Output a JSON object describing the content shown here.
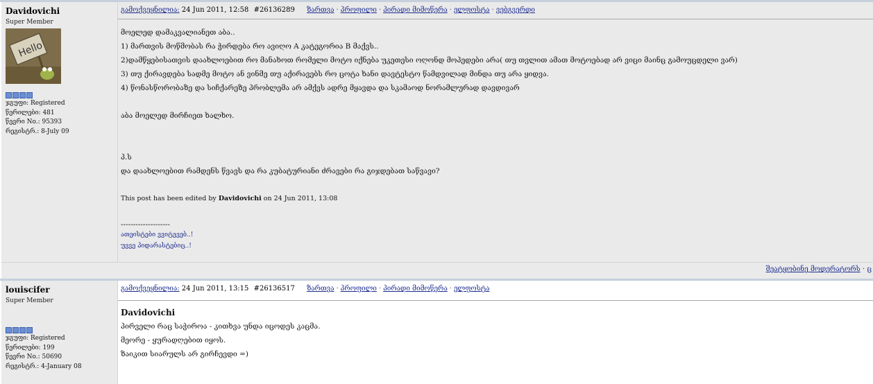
{
  "post1": {
    "username": "Davidovichi",
    "user_title": "Super Member",
    "avatar_text": "Hello",
    "info": [
      "ჯგუფი: Registered",
      "წერილები: 481",
      "წევრი No.: 95393",
      "რეგისტრ.: 8-July 09"
    ],
    "posted_label": "გამოქვეყნილია:",
    "posted_date": "24 Jun 2011, 12:58",
    "post_id": "#26136289",
    "actions": [
      "ზართვა",
      "პროფილი",
      "პირადი მიმოწერა",
      "ელფოსტა",
      "ვებგვერდი"
    ],
    "lines": [
      "მოელედ დამაკვალიანეთ აბა..",
      "1) მართვის მოწმობას რა ჭირდება რო ავიღო A კატეგორია B მაქვს..",
      "2)დამწყებისათვის დაახლოებით რო მანახოთ რომელი მოტო იქნება უკეთესი ოღონდ მოპედები არა( თუ თვლით ამათ მოტოებად არ ვიცი მაინც გამოუცდელი ვარ)",
      "3) თუ ქირავდება სადმე მოტო ან ვინმე თუ აქირავებს რო ცოტა ხანი დავტესტო წამდვილად მინდა თუ არა ყიდვა.",
      "4) წონასწორობაზე და სიჩქარეზე პრობლემა არ ამქვს ადრე მყავდა და სკამაოდ ნორამლურად დავდივარ",
      "",
      "აბა მოელედ მირჩიეთ ხალხო.",
      "",
      "",
      "პ.ს",
      "და დაახლოებით რამდენს წვავს და რა კუბატურიანი ძრავები რა გიჯდებათ საწვავი?"
    ],
    "edited_prefix": "This post has been edited by",
    "edited_by": "Davidovichi",
    "edited_suffix": "on 24 Jun 2011, 13:08",
    "sig_rule": "--------------------",
    "sig_lines": [
      "ათეისტები ვვიტევებ..!",
      "უვვე პიდარასტებიც..!"
    ],
    "footer_link": "შეატყობინე მოდერატორს",
    "footer_cut": "·  ც"
  },
  "post2": {
    "username": "louiscifer",
    "user_title": "Super Member",
    "info": [
      "ჯგუფი: Registered",
      "წერილები: 199",
      "წევრი No.: 50690",
      "რეგისტრ.: 4-January 08"
    ],
    "posted_label": "გამოქვეყნილია:",
    "posted_date": "24 Jun 2011, 13:15",
    "post_id": "#26136517",
    "actions": [
      "ზართვა",
      "პროფილი",
      "პირადი მიმოწერა",
      "ელფოსტა"
    ],
    "quote_name": "Davidovichi",
    "lines": [
      "პირველი რაც საჭიროა - კითხვა უნდა იცოდეს კაცმა.",
      "მეორე - ყურადღებით იყოს.",
      "ზაიკით სიარულს არ გირჩევდი =)"
    ]
  },
  "colors": {
    "panel": "#eaeaea",
    "link": "#1b2b8f",
    "pip": "#6a8fd6"
  }
}
